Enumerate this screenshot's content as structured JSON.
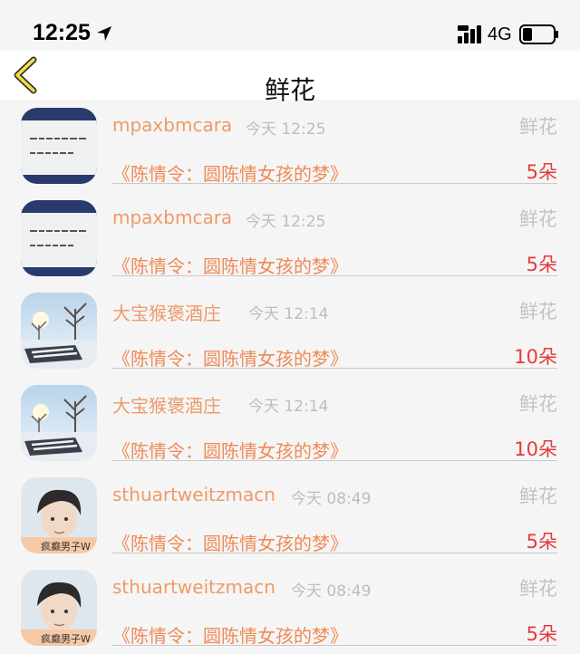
{
  "status_bar": {
    "time": "12:25",
    "network": "4G"
  },
  "nav": {
    "title": "鲜花"
  },
  "feed": [
    {
      "avatar": "note-photo-avatar",
      "username": "mpaxbmcara",
      "time": "今天 12:25",
      "gift_type": "鲜花",
      "book": "《陈情令：圆陈情女孩的梦》",
      "count": "5朵"
    },
    {
      "avatar": "note-photo-avatar",
      "username": "mpaxbmcara",
      "time": "今天 12:25",
      "gift_type": "鲜花",
      "book": "《陈情令：圆陈情女孩的梦》",
      "count": "5朵"
    },
    {
      "avatar": "winter-trees-avatar",
      "username": "大宝猴褒酒庄",
      "time": "今天 12:14",
      "gift_type": "鲜花",
      "book": "《陈情令：圆陈情女孩的梦》",
      "count": "10朵"
    },
    {
      "avatar": "winter-trees-avatar",
      "username": "大宝猴褒酒庄",
      "time": "今天 12:14",
      "gift_type": "鲜花",
      "book": "《陈情令：圆陈情女孩的梦》",
      "count": "10朵"
    },
    {
      "avatar": "portrait-avatar",
      "avatar_text": "疯癫男子W",
      "username": "sthuartweitzmacn",
      "time": "今天 08:49",
      "gift_type": "鲜花",
      "book": "《陈情令：圆陈情女孩的梦》",
      "count": "5朵"
    },
    {
      "avatar": "portrait-avatar",
      "avatar_text": "疯癫男子W",
      "username": "sthuartweitzmacn",
      "time": "今天 08:49",
      "gift_type": "鲜花",
      "book": "《陈情令：圆陈情女孩的梦》",
      "count": "5朵"
    }
  ]
}
